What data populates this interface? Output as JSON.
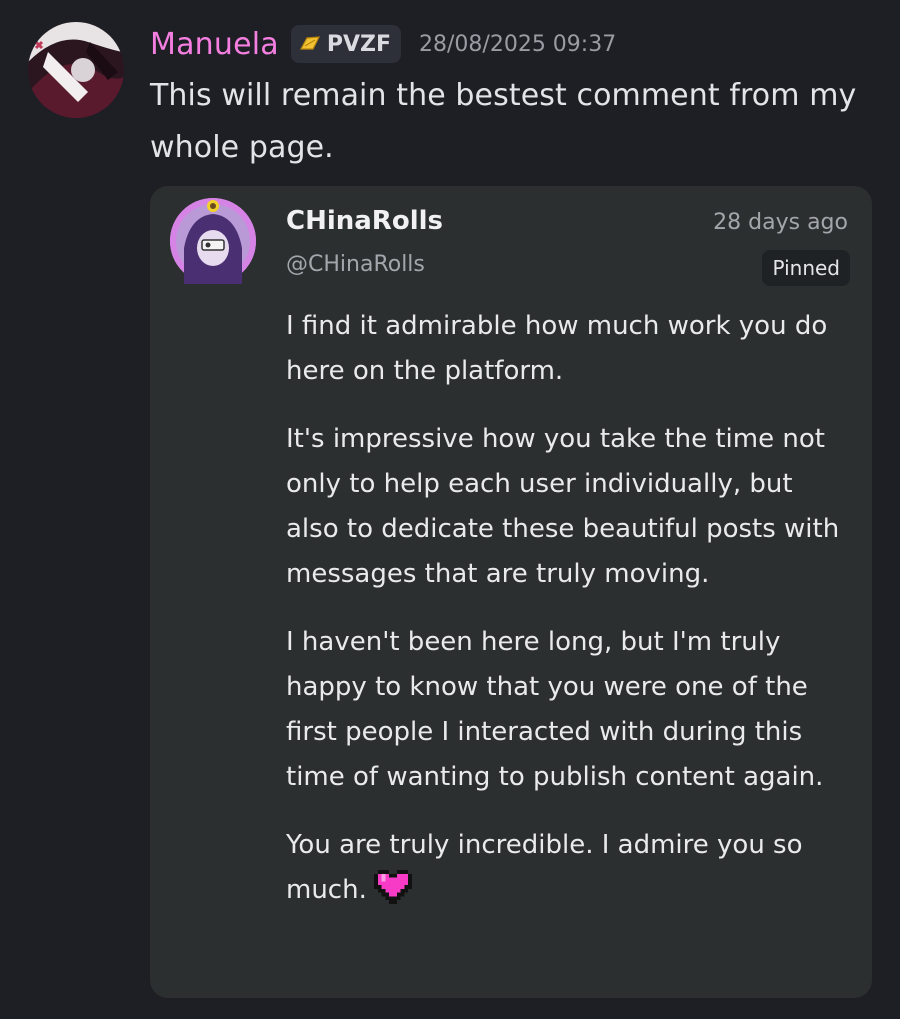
{
  "message": {
    "author": "Manuela",
    "author_color": "#f47fe0",
    "tag": {
      "icon": "gold-leaf-icon",
      "label": "PVZF"
    },
    "timestamp": "28/08/2025 09:37",
    "text": "This will remain the bestest comment from my whole page."
  },
  "embed": {
    "author_name": "CHinaRolls",
    "handle": "@CHinaRolls",
    "time": "28 days ago",
    "badge": "Pinned",
    "paragraphs": [
      "I find it admirable how much work you do here on the platform.",
      "It's impressive how you take the time not only to help each user individually, but also to dedicate these beautiful posts with messages that are truly moving.",
      "I haven't been here long, but I'm truly happy to know that you were one of the first people I interacted with during this time of wanting to publish content again.",
      "You are truly incredible. I admire you so much."
    ],
    "end_icon": "pink-pixel-heart-icon"
  }
}
